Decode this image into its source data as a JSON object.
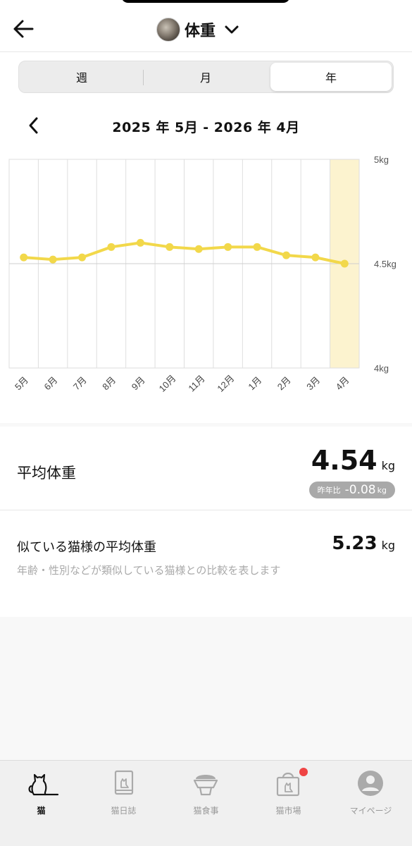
{
  "header": {
    "title": "体重"
  },
  "segments": [
    "週",
    "月",
    "年"
  ],
  "active_segment": 2,
  "range": {
    "label": "2025 年 5月 - 2026 年 4月"
  },
  "chart_data": {
    "type": "line",
    "categories": [
      "5月",
      "6月",
      "7月",
      "8月",
      "9月",
      "10月",
      "11月",
      "12月",
      "1月",
      "2月",
      "3月",
      "4月"
    ],
    "series": [
      {
        "values": [
          4.53,
          4.52,
          4.53,
          4.58,
          4.6,
          4.58,
          4.57,
          4.58,
          4.58,
          4.54,
          4.53,
          4.5
        ]
      }
    ],
    "ylim": [
      4,
      5
    ],
    "ytick_labels": [
      "5kg",
      "4.5kg",
      "4kg"
    ],
    "highlighted_category": "4月",
    "colors": {
      "line": "#f2d84a",
      "highlight": "#fcf3cf",
      "grid": "#dedede"
    }
  },
  "average": {
    "label": "平均体重",
    "value": "4.54",
    "unit": "kg",
    "diff_label": "昨年比",
    "diff_value": "-0.08",
    "diff_unit": "kg"
  },
  "similar": {
    "label": "似ている猫様の平均体重",
    "value": "5.23",
    "unit": "kg",
    "note": "年齢・性別などが類似している猫様との比較を表します"
  },
  "tabs": [
    {
      "label": "猫",
      "icon": "cat-icon",
      "active": true
    },
    {
      "label": "猫日誌",
      "icon": "diary-icon",
      "active": false
    },
    {
      "label": "猫食事",
      "icon": "food-bowl-icon",
      "active": false
    },
    {
      "label": "猫市場",
      "icon": "shopping-bag-icon",
      "active": false,
      "badge": true
    },
    {
      "label": "マイページ",
      "icon": "profile-icon",
      "active": false
    }
  ]
}
